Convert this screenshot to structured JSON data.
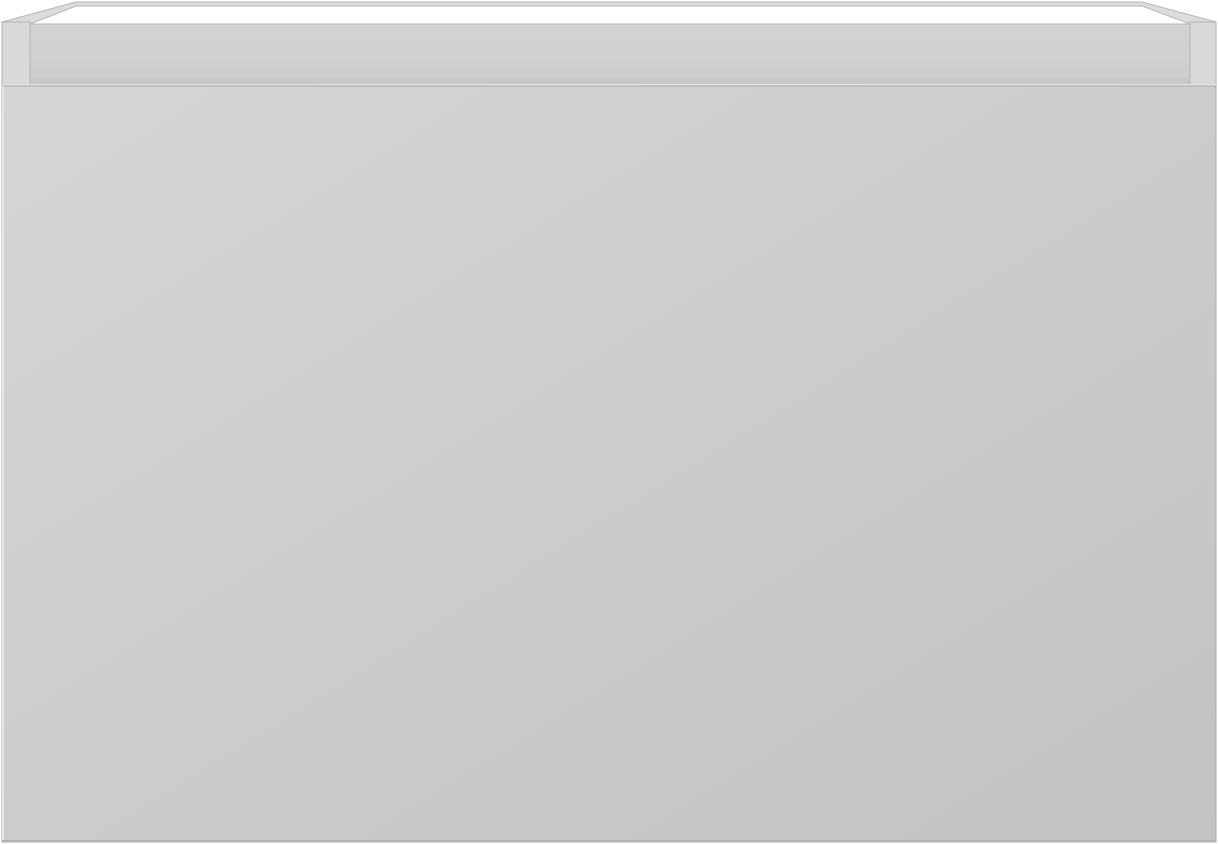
{
  "image": {
    "subject": "cabinet-drawer-unit",
    "view": "front",
    "colors": {
      "background": "#ffffff",
      "front_panel_light": "#d5d5d3",
      "front_panel_dark": "#c3c3c1",
      "inner_back_wall": "#cfcfcd",
      "top_edge": "#e0e0df",
      "side_wall": "#d9d9d7",
      "outline": "#a9a9a7"
    }
  }
}
